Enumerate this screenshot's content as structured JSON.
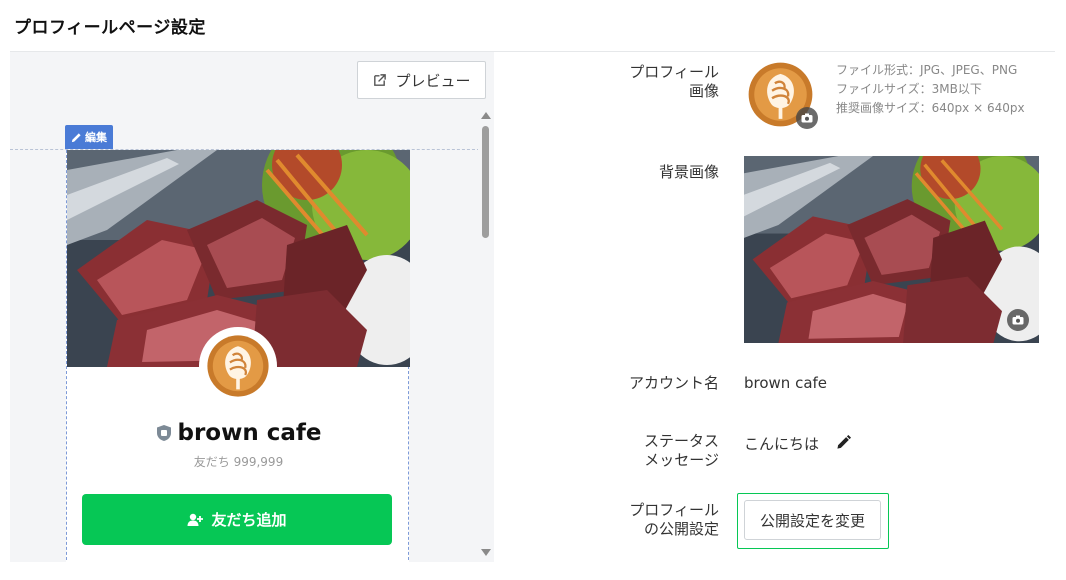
{
  "page": {
    "title": "プロフィールページ設定"
  },
  "preview": {
    "button_label": "プレビュー",
    "edit_badge": "編集",
    "account_name": "brown cafe",
    "friends_count": "友だち 999,999",
    "add_friend_label": "友だち追加"
  },
  "settings": {
    "profile_image": {
      "label_line1": "プロフィール",
      "label_line2": "画像",
      "info_format": "ファイル形式：JPG、JPEG、PNG",
      "info_size": "ファイルサイズ：3MB以下",
      "info_recommended": "推奨画像サイズ：640px × 640px"
    },
    "background_image": {
      "label": "背景画像"
    },
    "account_name": {
      "label": "アカウント名",
      "value": "brown cafe"
    },
    "status_message": {
      "label_line1": "ステータス",
      "label_line2": "メッセージ",
      "value": "こんにちは"
    },
    "visibility": {
      "label_line1": "プロフィール",
      "label_line2": "の公開設定",
      "button_label": "公開設定を変更"
    }
  },
  "colors": {
    "accent_green": "#06c755",
    "edit_blue": "#4a7bd6"
  },
  "icons": [
    "external-link-icon",
    "pencil-icon",
    "shield-icon",
    "add-friend-icon",
    "camera-icon"
  ]
}
